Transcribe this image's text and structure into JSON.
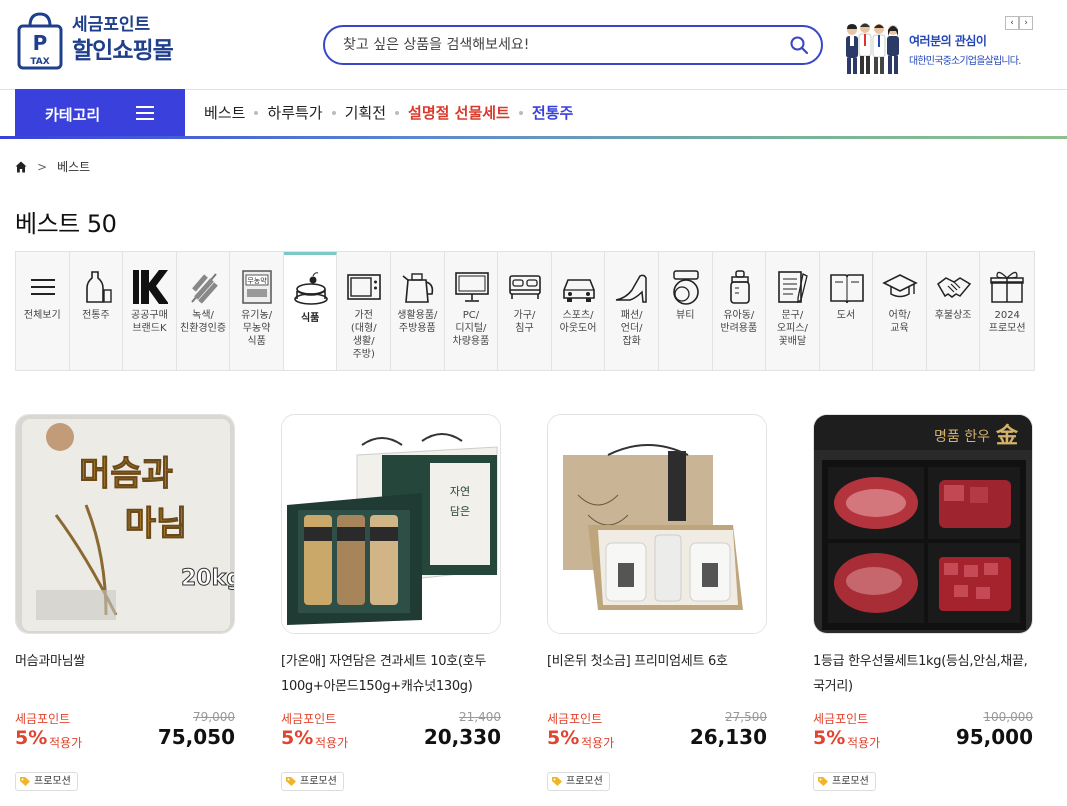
{
  "header": {
    "logo_sub": "세금포인트",
    "logo_main": "할인쇼핑몰",
    "logo_bag_label": "TAX",
    "logo_bag_letter": "P",
    "search_placeholder": "찾고 싶은 상품을 검색해보세요!",
    "banner_line1": "여러분의 관심이",
    "banner_line2": "대한민국중소기업을살립니다.",
    "banner_prev": "‹",
    "banner_next": "›"
  },
  "nav": {
    "category_button": "카테고리",
    "links": [
      {
        "label": "베스트",
        "color": "#222222",
        "bold": false
      },
      {
        "label": "하루특가",
        "color": "#222222",
        "bold": false
      },
      {
        "label": "기획전",
        "color": "#222222",
        "bold": false
      },
      {
        "label": "설명절 선물세트",
        "color": "#d93a2b",
        "bold": true
      },
      {
        "label": "전통주",
        "color": "#3a40db",
        "bold": true
      }
    ]
  },
  "breadcrumb": {
    "home_icon": "home-icon",
    "separator": ">",
    "current": "베스트"
  },
  "page_title": "베스트 50",
  "categories": [
    {
      "label": "전체보기",
      "icon": "menu-icon"
    },
    {
      "label": "전통주",
      "icon": "liquor-icon"
    },
    {
      "label": "공공구매\n브랜드K",
      "icon": "brand-k-icon"
    },
    {
      "label": "녹색/\n친환경인증",
      "icon": "leaf-icon"
    },
    {
      "label": "유기농/\n무농약\n식품",
      "icon": "organic-icon"
    },
    {
      "label": "식품",
      "icon": "cake-icon",
      "active": true
    },
    {
      "label": "가전\n(대형/\n생활/\n주방)",
      "icon": "microwave-icon"
    },
    {
      "label": "생활용품/\n주방용품",
      "icon": "kettle-icon"
    },
    {
      "label": "PC/\n디지털/\n차량용품",
      "icon": "monitor-icon"
    },
    {
      "label": "가구/\n침구",
      "icon": "bed-icon"
    },
    {
      "label": "스포츠/\n아웃도어",
      "icon": "car-icon"
    },
    {
      "label": "패션/\n언더/\n잡화",
      "icon": "heel-icon"
    },
    {
      "label": "뷰티",
      "icon": "compact-icon"
    },
    {
      "label": "유아동/\n반려용품",
      "icon": "bottle-icon"
    },
    {
      "label": "문구/\n오피스/\n꽃배달",
      "icon": "notepad-icon"
    },
    {
      "label": "도서",
      "icon": "book-icon"
    },
    {
      "label": "어학/\n교육",
      "icon": "graduation-icon"
    },
    {
      "label": "후불상조",
      "icon": "handshake-icon"
    },
    {
      "label": "2024\n프로모션",
      "icon": "gift-icon"
    }
  ],
  "products": [
    {
      "name": "머슴과마님쌀",
      "image": "rice-bag-image",
      "point_label": "세금포인트",
      "original_price": "79,000",
      "rate": "5%",
      "rate_suffix": "적용가",
      "price": "75,050",
      "badge": "프로모션"
    },
    {
      "name": "[가온애] 자연담은 견과세트 10호(호두100g+아몬드150g+캐슈넛130g)",
      "image": "nut-gift-set-image",
      "point_label": "세금포인트",
      "original_price": "21,400",
      "rate": "5%",
      "rate_suffix": "적용가",
      "price": "20,330",
      "badge": "프로모션"
    },
    {
      "name": "[비온뒤 첫소금] 프리미엄세트 6호",
      "image": "salt-gift-set-image",
      "point_label": "세금포인트",
      "original_price": "27,500",
      "rate": "5%",
      "rate_suffix": "적용가",
      "price": "26,130",
      "badge": "프로모션"
    },
    {
      "name": "1등급 한우선물세트1kg(등심,안심,채끝,국거리)",
      "image": "hanwoo-gift-set-image",
      "point_label": "세금포인트",
      "original_price": "100,000",
      "rate": "5%",
      "rate_suffix": "적용가",
      "price": "95,000",
      "badge": "프로모션"
    }
  ],
  "colors": {
    "brand_blue": "#3a40db",
    "logo_navy": "#1f3f8c",
    "point_red": "#e0452f",
    "active_teal": "#7dc7c4"
  }
}
